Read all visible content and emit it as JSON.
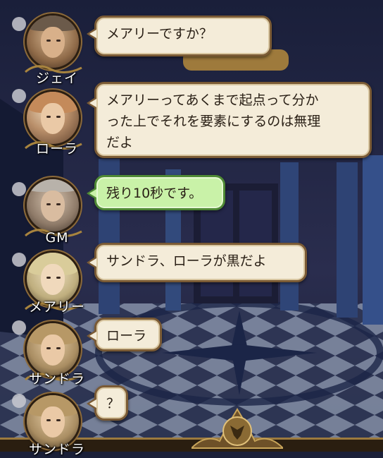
{
  "messages": [
    {
      "speaker": "ジェイ",
      "text": "メアリーですか？",
      "style": "normal"
    },
    {
      "speaker": "ローラ",
      "text": "メアリーってあくまで起点って分か\nった上でそれを要素にするのは無理\nだよ",
      "style": "normal"
    },
    {
      "speaker": "GM",
      "text": "残り10秒です。",
      "style": "green"
    },
    {
      "speaker": "メアリー",
      "text": "サンドラ、ローラが黒だよ",
      "style": "normal"
    },
    {
      "speaker": "サンドラ",
      "text": "ローラ",
      "style": "normal"
    },
    {
      "speaker": "サンドラ",
      "text": "？",
      "style": "normal"
    }
  ],
  "colors": {
    "bubble": "#f4ecd9",
    "bubble_border": "#7b5b35",
    "gm_bubble": "#c9f2a8",
    "name_text": "#ffffff"
  },
  "icons": {
    "bottom_emblem": "wolf-crest-icon"
  }
}
